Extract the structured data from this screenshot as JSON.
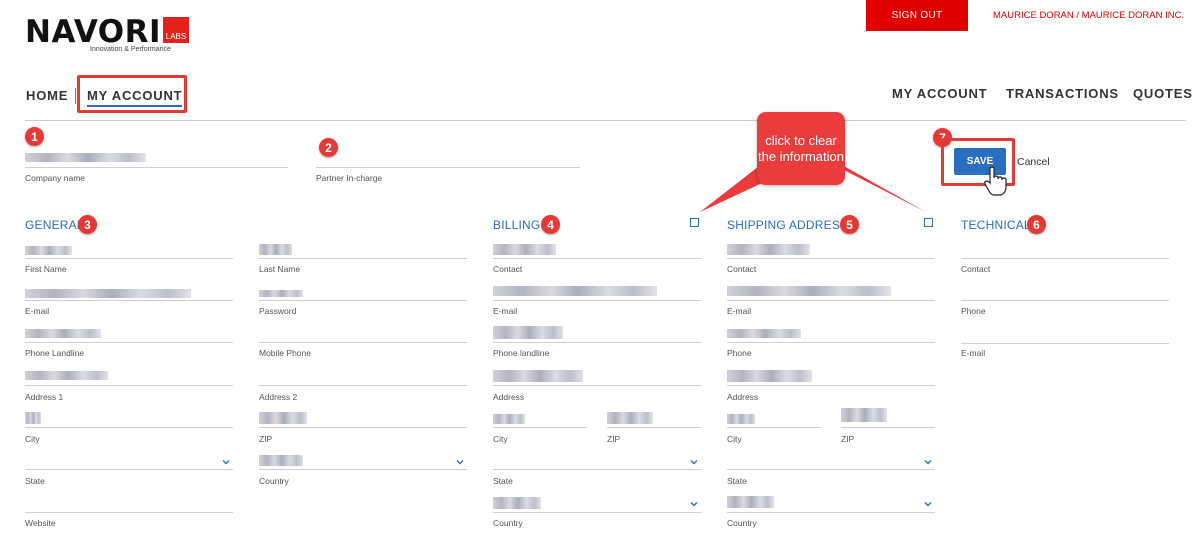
{
  "header": {
    "logo": "NAVORI",
    "logo_badge": "LABS",
    "tagline": "Innovation & Performance",
    "sign_out": "SIGN OUT",
    "user": "MAURICE DORAN / MAURICE DORAN INC."
  },
  "breadcrumb": {
    "home": "HOME",
    "current": "MY ACCOUNT"
  },
  "top_nav": {
    "my_account": "MY ACCOUNT",
    "transactions": "TRANSACTIONS",
    "quotes": "QUOTES"
  },
  "badges": [
    "1",
    "2",
    "3",
    "4",
    "5",
    "6",
    "7"
  ],
  "company": {
    "company_name_label": "Company name",
    "partner_label": "Partner In-charge"
  },
  "actions": {
    "save": "SAVE",
    "cancel": "Cancel"
  },
  "callout": {
    "text": "click to clear the information"
  },
  "general": {
    "title": "GENERAL",
    "labels": {
      "first_name": "First Name",
      "last_name": "Last Name",
      "email": "E-mail",
      "password": "Password",
      "phone_landline": "Phone Landline",
      "mobile_phone": "Mobile Phone",
      "address1": "Address 1",
      "address2": "Address 2",
      "city": "City",
      "zip": "ZIP",
      "state": "State",
      "country": "Country",
      "website": "Website"
    }
  },
  "billing": {
    "title": "BILLING",
    "labels": {
      "contact": "Contact",
      "email": "E-mail",
      "phone": "Phone landline",
      "address": "Address",
      "city": "City",
      "zip": "ZIP",
      "state": "State",
      "country": "Country"
    }
  },
  "shipping": {
    "title": "SHIPPING ADDRESS",
    "labels": {
      "contact": "Contact",
      "email": "E-mail",
      "phone": "Phone",
      "address": "Address",
      "city": "City",
      "zip": "ZIP",
      "state": "State",
      "country": "Country"
    }
  },
  "technical": {
    "title": "TECHNICAL",
    "labels": {
      "contact": "Contact",
      "phone": "Phone",
      "email": "E-mail"
    }
  },
  "colors": {
    "accent": "#2a6ebf",
    "brand_red": "#e00000",
    "annotation_red": "#e53935"
  },
  "icons": [
    "chevron-down-icon",
    "checkbox-icon",
    "hand-cursor-icon"
  ]
}
